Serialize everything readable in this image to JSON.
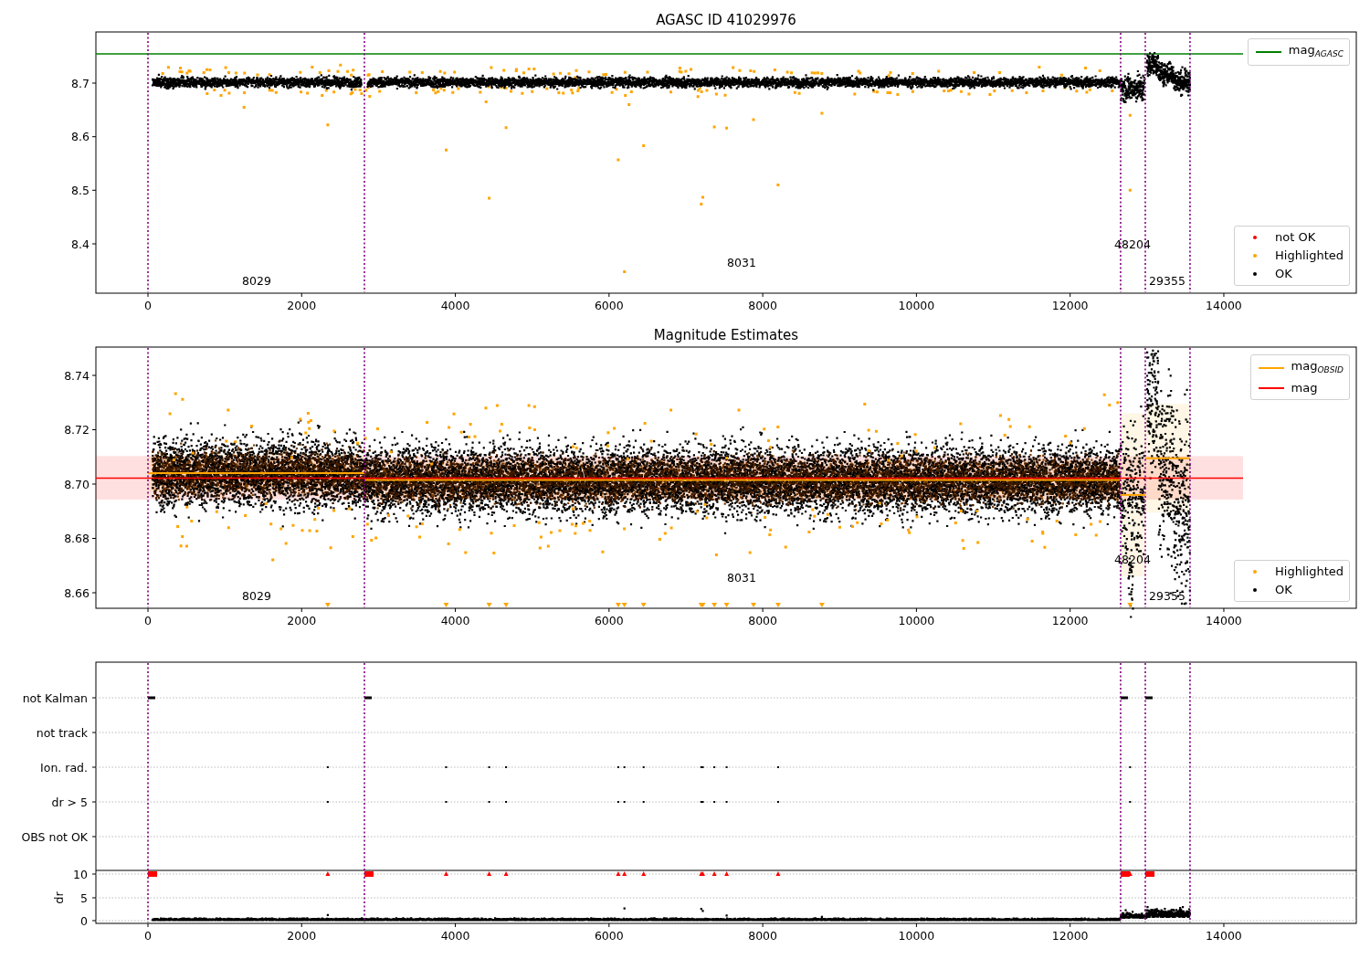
{
  "panels": [
    {
      "kind": "magnitude",
      "title": "AGASC ID 41029976",
      "x_ticks": [
        "0",
        "2000",
        "4000",
        "6000",
        "8000",
        "10000",
        "12000",
        "14000"
      ],
      "y_ticks": [
        "8.7",
        "8.6",
        "8.5",
        "8.4"
      ],
      "obsid_labels": [
        "8029",
        "8031",
        "48204",
        "29355"
      ],
      "legends": [
        [
          {
            "label": "mag$_{AGASC}$",
            "kind": "line",
            "color": "#008000"
          }
        ],
        [
          {
            "label": "not OK",
            "kind": "point",
            "color": "#ff0000"
          },
          {
            "label": "Highlighted",
            "kind": "point",
            "color": "#ffa500"
          },
          {
            "label": "OK",
            "kind": "point",
            "color": "#000000"
          }
        ]
      ]
    },
    {
      "kind": "estimates",
      "title": "Magnitude Estimates",
      "x_ticks": [
        "0",
        "2000",
        "4000",
        "6000",
        "8000",
        "10000",
        "12000",
        "14000"
      ],
      "y_ticks": [
        "8.74",
        "8.72",
        "8.70",
        "8.68",
        "8.66"
      ],
      "obsid_labels": [
        "8029",
        "8031",
        "48204",
        "29355"
      ],
      "legends": [
        [
          {
            "label": "mag$_{OBSID}$",
            "kind": "line",
            "color": "#ffa500"
          },
          {
            "label": "mag",
            "kind": "line",
            "color": "#ff0000"
          }
        ],
        [
          {
            "label": "Highlighted",
            "kind": "point",
            "color": "#ffa500"
          },
          {
            "label": "OK",
            "kind": "point",
            "color": "#000000"
          }
        ]
      ]
    },
    {
      "kind": "flags",
      "x_ticks": [
        "0",
        "2000",
        "4000",
        "6000",
        "8000",
        "10000",
        "12000",
        "14000"
      ],
      "flag_labels": [
        "not Kalman",
        "not track",
        "Ion. rad.",
        "dr > 5",
        "OBS not OK"
      ],
      "dr_ticks": [
        "10",
        "5",
        "0"
      ],
      "dr_label": "dr"
    }
  ]
}
